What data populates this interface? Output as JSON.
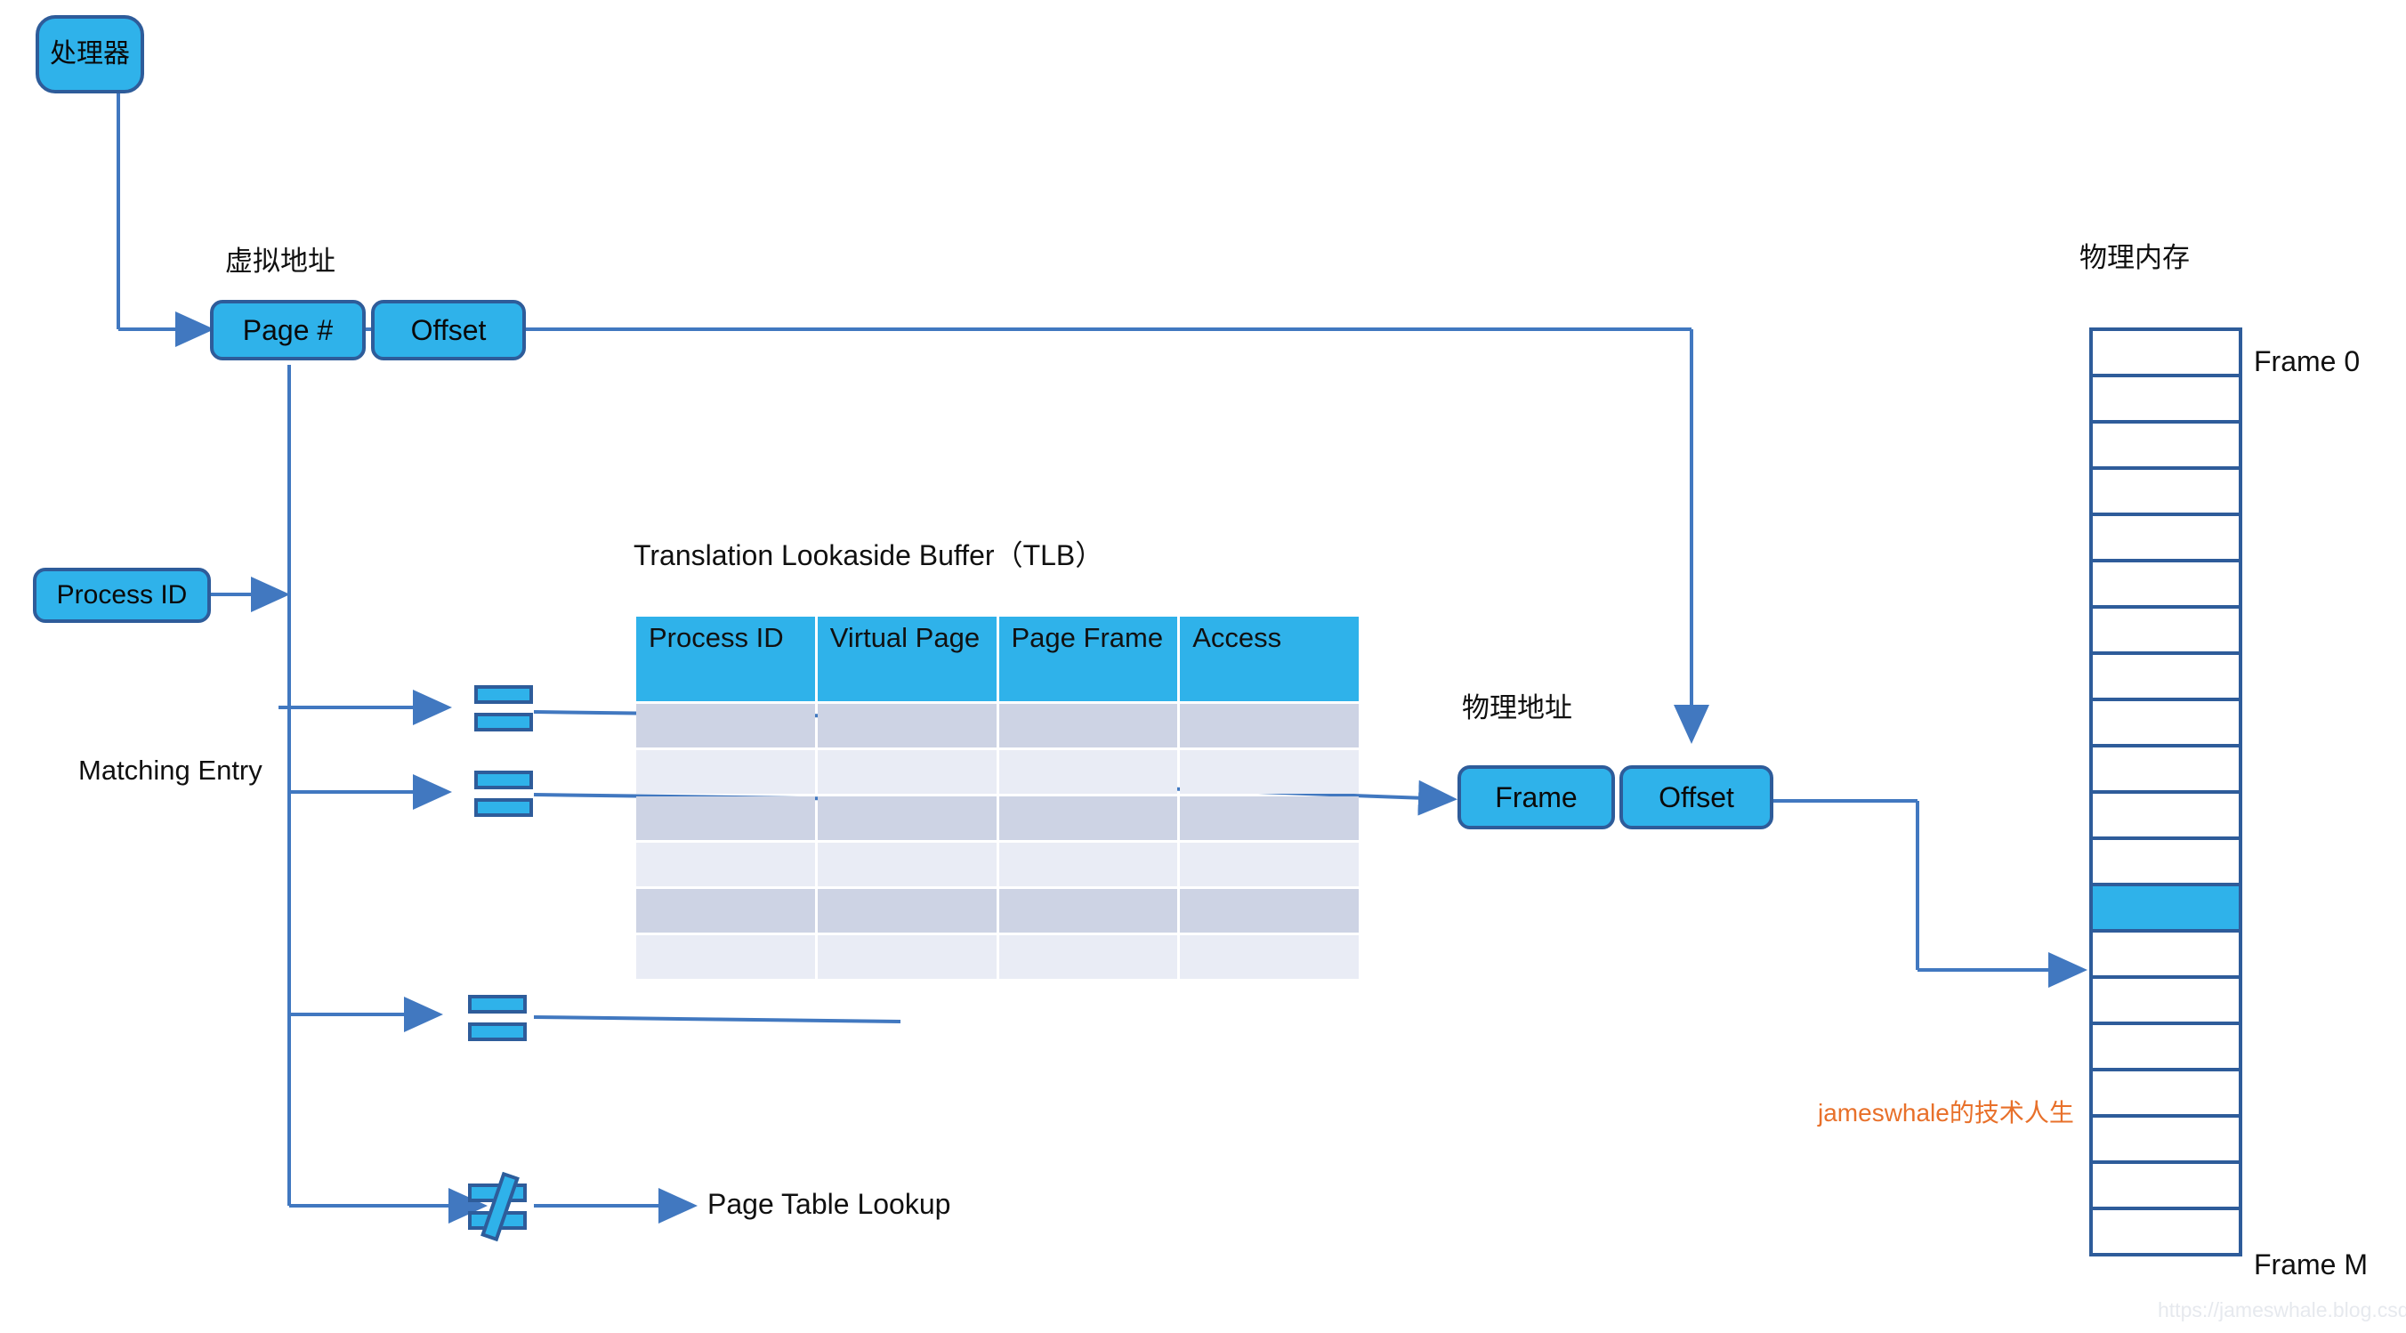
{
  "diagram": {
    "title_hidden": "TLB address translation diagram",
    "colors": {
      "node_fill": "#2FB2EA",
      "node_stroke": "#2E5C9A",
      "wire": "#4178C0",
      "table_header": "#2FB2EA",
      "row_dark": "#CDD3E4",
      "row_light": "#E9ECF5",
      "accent_orange": "#E8702A",
      "watermark_grey": "#E6E9EE"
    }
  },
  "nodes": {
    "processor": "处理器",
    "page_number": "Page #",
    "virtual_offset": "Offset",
    "process_id": "Process ID",
    "frame": "Frame",
    "physical_offset": "Offset"
  },
  "labels": {
    "virtual_address": "虚拟地址",
    "physical_address": "物理地址",
    "physical_memory": "物理内存",
    "matching_entry": "Matching Entry",
    "page_table_lookup": "Page Table Lookup",
    "tlb_title": "Translation Lookaside Buffer（TLB）",
    "frame_first": "Frame 0",
    "frame_last": "Frame M"
  },
  "tlb": {
    "columns": [
      "Process ID",
      "Virtual Page",
      "Page Frame",
      "Access"
    ],
    "rows": [
      {
        "band": "dark",
        "cells": [
          "",
          "",
          "",
          ""
        ]
      },
      {
        "band": "light",
        "cells": [
          "",
          "",
          "",
          ""
        ]
      },
      {
        "band": "dark",
        "cells": [
          "",
          "",
          "",
          ""
        ]
      },
      {
        "band": "light",
        "cells": [
          "",
          "",
          "",
          ""
        ]
      },
      {
        "band": "dark",
        "cells": [
          "",
          "",
          "",
          ""
        ]
      },
      {
        "band": "light",
        "cells": [
          "",
          "",
          "",
          ""
        ]
      }
    ]
  },
  "memory": {
    "frame_count": 20,
    "highlighted_index": 12,
    "first_label": "Frame 0",
    "last_label": "Frame M"
  },
  "symbols": {
    "equal_1": "=",
    "equal_2": "=",
    "equal_3": "=",
    "not_equal": "≠"
  },
  "watermarks": {
    "blog_name": "jameswhale的技术人生",
    "blog_url": "https://jameswhale.blog.csdn.net"
  }
}
